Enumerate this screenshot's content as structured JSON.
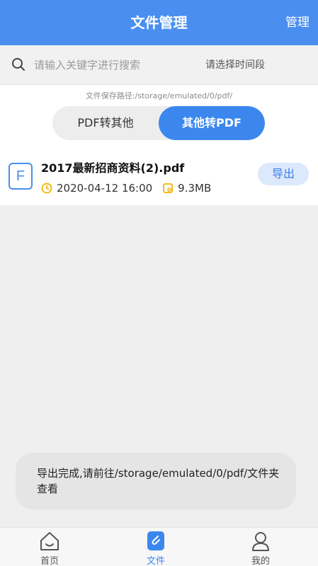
{
  "header": {
    "title": "文件管理",
    "manage_label": "管理"
  },
  "search": {
    "placeholder": "请输入关键字进行搜索",
    "value": "",
    "time_select_label": "请选择时间段"
  },
  "path_text": "文件保存路径:/storage/emulated/0/pdf/",
  "toggle": {
    "left_label": "PDF转其他",
    "right_label": "其他转PDF",
    "active": "right"
  },
  "files": [
    {
      "icon_letter": "F",
      "name": "2017最新招商资料(2).pdf",
      "date": "2020-04-12 16:00",
      "size": "9.3MB",
      "action_label": "导出"
    }
  ],
  "toast": {
    "text": "导出完成,请前往/storage/emulated/0/pdf/文件夹查看"
  },
  "tabs": [
    {
      "label": "首页",
      "icon": "home-icon"
    },
    {
      "label": "文件",
      "icon": "file-clip-icon",
      "active": true
    },
    {
      "label": "我的",
      "icon": "user-icon"
    }
  ],
  "colors": {
    "accent": "#4a8ff0",
    "active_tab": "#3b87ee",
    "date_icon": "#f0b400"
  }
}
